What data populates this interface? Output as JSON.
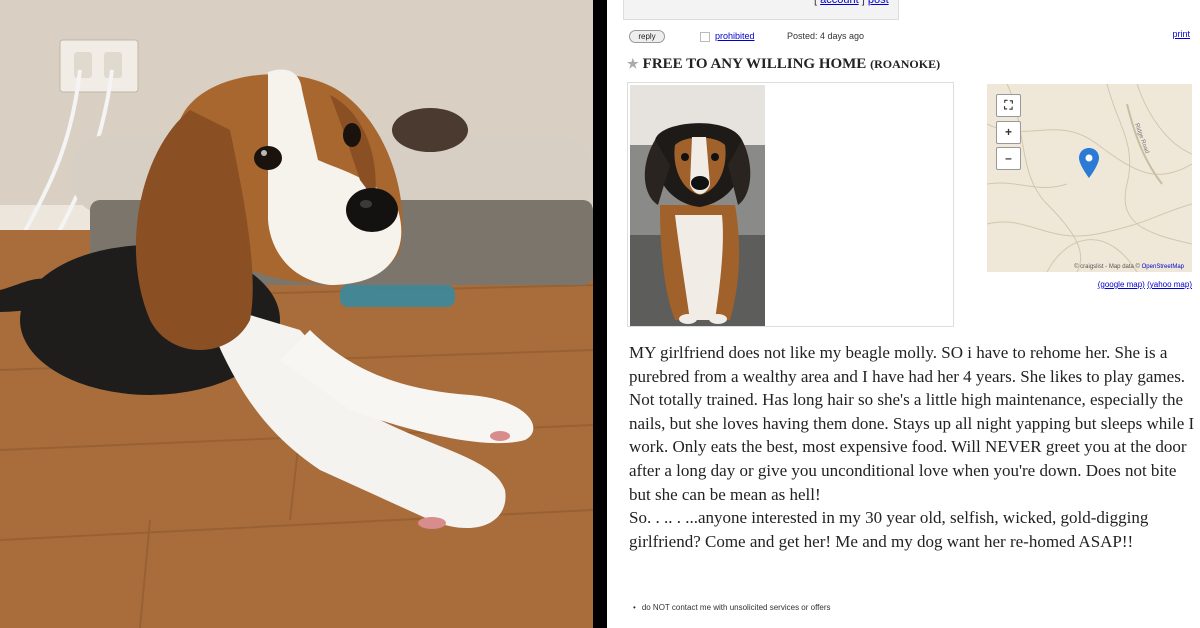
{
  "listing": {
    "top_links": {
      "open_bracket": "[",
      "account": "account",
      "close_bracket": "]",
      "post": "post"
    },
    "reply_label": "reply",
    "prohibited_label": "prohibited",
    "posted": "Posted: 4 days ago",
    "print_label": "print",
    "title": "FREE TO ANY WILLING HOME",
    "location": "(ROANOKE)",
    "map": {
      "fullscreen_symbol": "⛶",
      "zoom_in": "+",
      "zoom_out": "–",
      "attribution": "© craigslist - Map data ©",
      "attribution_link": "OpenStreetMap",
      "google_map": "(google map)",
      "yahoo_map": "(yahoo map)",
      "street_label": "Ridge Road"
    },
    "body_paragraph_1": "MY girlfriend does not like my beagle molly. SO i have to rehome her. She is a purebred from a wealthy area and I have had her 4 years. She likes to play games. Not totally trained. Has long hair so she's a little high maintenance, especially the nails, but she loves having them done. Stays up all night yapping but sleeps while I work. Only eats the best, most expensive food. Will NEVER greet you at the door after a long day or give you unconditional love when you're down. Does not bite but she can be mean as hell!",
    "body_paragraph_2": "So. . .. . ...anyone interested in my 30 year old, selfish, wicked, gold-digging girlfriend? Come and get her! Me and my dog want her re-homed ASAP!!",
    "notice": "do NOT contact me with unsolicited services or offers"
  },
  "colors": {
    "link": "#0000cc",
    "map_pin": "#2b7bd6",
    "map_bg": "#efe8d8"
  }
}
